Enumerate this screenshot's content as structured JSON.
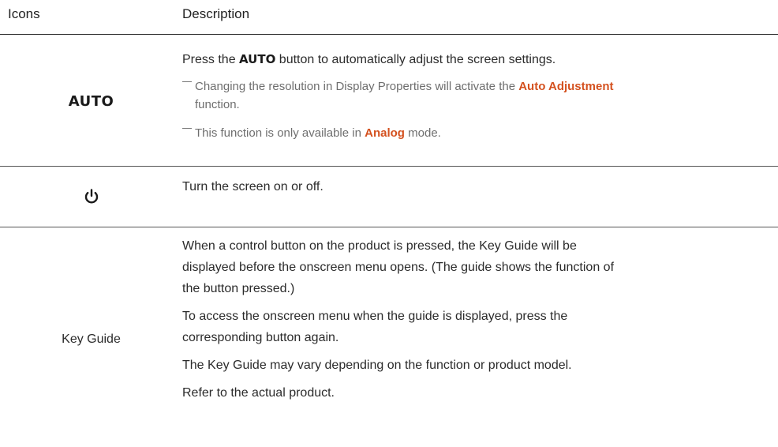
{
  "header": {
    "icons_label": "Icons",
    "description_label": "Description"
  },
  "rows": [
    {
      "icon_text": "AUTO",
      "main_before": "Press the ",
      "main_key": "AUTO",
      "main_after": " button to automatically adjust the screen settings.",
      "note1_before": "Changing the resolution in Display Properties will activate the ",
      "note1_highlight": "Auto Adjustment",
      "note1_after": "function.",
      "note2_before": "This function is only available in ",
      "note2_highlight": "Analog",
      "note2_after": " mode."
    },
    {
      "icon": "power-icon",
      "text": "Turn the screen on or off."
    },
    {
      "icon_text": "Key Guide",
      "p1_l1": "When a control button on the product is pressed, the Key Guide will be",
      "p1_l2": "displayed before the onscreen menu opens. (The guide shows the function of",
      "p1_l3": "the button pressed.)",
      "p2_l1": "To access the onscreen menu when the guide is displayed, press the",
      "p2_l2": "corresponding button again.",
      "p3": "The Key Guide may vary depending on the function or product model.",
      "p4": "Refer to the actual product."
    }
  ],
  "colors": {
    "highlight": "#d4511f",
    "note_text": "#6e6e6e",
    "body_text": "#2b2b2b"
  }
}
